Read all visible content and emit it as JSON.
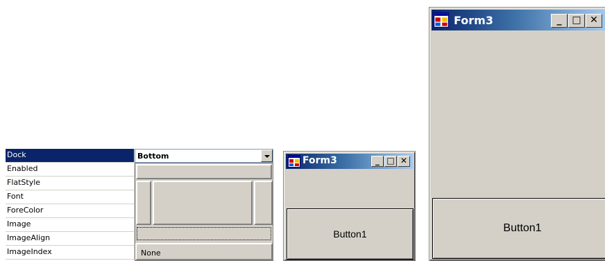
{
  "property_grid": {
    "selected_property": "Dock",
    "properties": [
      "Dock",
      "Enabled",
      "FlatStyle",
      "Font",
      "ForeColor",
      "Image",
      "ImageAlign",
      "ImageIndex"
    ],
    "dock_value": "Bottom",
    "dock_picker": {
      "none_label": "None",
      "selected_region": "Bottom"
    },
    "colors": {
      "selection": "#0a246a",
      "picker_face": "#d4d0c8"
    }
  },
  "small_window": {
    "title": "Form3",
    "caption_buttons": [
      "minimize",
      "maximize",
      "close"
    ],
    "button_label": "Button1"
  },
  "large_window": {
    "title": "Form3",
    "caption_buttons": [
      "minimize",
      "maximize",
      "close"
    ],
    "button_label": "Button1"
  },
  "icons": {
    "app": "form-icon",
    "minimize": "minimize-icon",
    "maximize": "maximize-icon",
    "close": "close-icon",
    "dropdown": "dropdown-arrow-icon"
  },
  "colors": {
    "title_gradient_start": "#0a246a",
    "title_gradient_end": "#a6caf0",
    "window_face": "#d4d0c8"
  }
}
